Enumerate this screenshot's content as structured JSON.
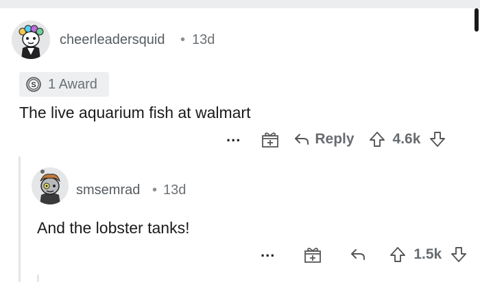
{
  "comment": {
    "username": "cheerleadersquid",
    "separator": "•",
    "age": "13d",
    "award_label": "1 Award",
    "body": "The live aquarium fish at walmart",
    "more_label": "...",
    "reply_label": "Reply",
    "score": "4.6k"
  },
  "reply": {
    "username": "smsemrad",
    "separator": "•",
    "age": "13d",
    "body": "And the lobster tanks!",
    "more_label": "...",
    "score": "1.5k"
  },
  "colors": {
    "meta_text": "#6b7075",
    "action_text": "#686c70",
    "award_bg": "#edeff1"
  }
}
